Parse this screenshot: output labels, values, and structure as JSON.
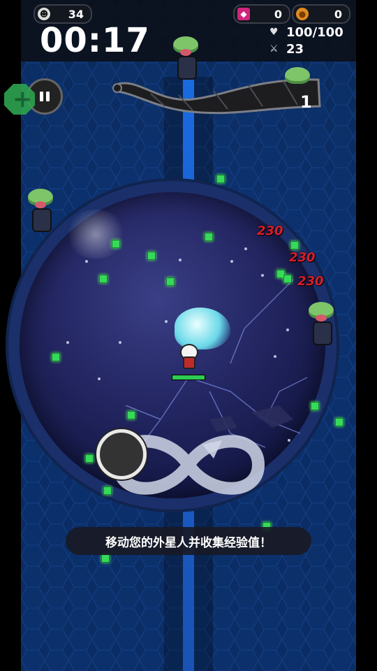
{
  "hud": {
    "skull_count": "34",
    "gem_count": "0",
    "coin_count": "0",
    "timer": "00:17",
    "hp_value": "100/100",
    "attack_value": "23"
  },
  "wave": {
    "number": "1"
  },
  "damage_numbers": [
    "230",
    "230",
    "230"
  ],
  "tutorial": {
    "text": "移动您的外星人并收集经验值！"
  },
  "player": {
    "hp_fraction": 1.0
  },
  "colors": {
    "xp_gem": "#36d95a",
    "damage": "#d61f2c",
    "hp_bar": "#2ecc52"
  },
  "icons": {
    "skull": "skull-icon",
    "gem": "gem-icon",
    "coin": "coin-icon",
    "heart": "heart-hp-icon",
    "sword": "sword-icon",
    "pause": "pause-icon",
    "plus": "plus-icon"
  }
}
